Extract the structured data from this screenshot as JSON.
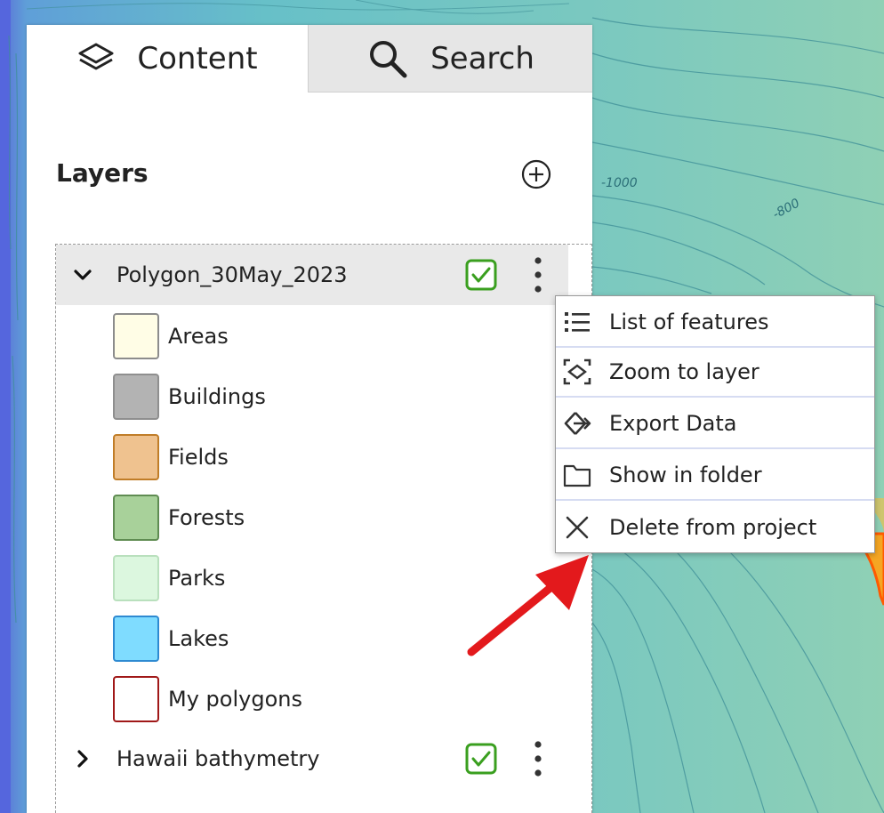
{
  "tabs": [
    {
      "label": "Content",
      "icon": "layers-icon"
    },
    {
      "label": "Search",
      "icon": "search-icon"
    }
  ],
  "layers_panel": {
    "title": "Layers",
    "add_icon": "add-layer-icon",
    "layers": [
      {
        "name": "Polygon_30May_2023",
        "expanded": true,
        "visible": true
      },
      {
        "name": "Hawaii bathymetry",
        "expanded": false,
        "visible": true
      }
    ],
    "legend": [
      {
        "label": "Areas",
        "fill": "#fffde6",
        "stroke": "#8c8c8c"
      },
      {
        "label": "Buildings",
        "fill": "#b3b3b3",
        "stroke": "#8f8f8f"
      },
      {
        "label": "Fields",
        "fill": "#efc28f",
        "stroke": "#c07d28"
      },
      {
        "label": "Forests",
        "fill": "#a8d19a",
        "stroke": "#5f8c52"
      },
      {
        "label": "Parks",
        "fill": "#dcf7df",
        "stroke": "#b9e0bd"
      },
      {
        "label": "Lakes",
        "fill": "#7fdcff",
        "stroke": "#2e8ad1"
      },
      {
        "label": "My polygons",
        "fill": "#ffffff",
        "stroke": "#a01818"
      }
    ]
  },
  "context_menu": {
    "items": [
      {
        "label": "List of features",
        "icon": "list-icon"
      },
      {
        "label": "Zoom to layer",
        "icon": "zoom-extent-icon"
      },
      {
        "label": "Export Data",
        "icon": "export-icon"
      },
      {
        "label": "Show in folder",
        "icon": "folder-icon"
      },
      {
        "label": "Delete from project",
        "icon": "close-icon"
      }
    ]
  },
  "map": {
    "contour_labels": [
      "-1000",
      "-800"
    ]
  },
  "colors": {
    "checkbox_green": "#3a9f1f",
    "arrow_red": "#e3191c",
    "menu_divider": "#d6dcf2"
  }
}
